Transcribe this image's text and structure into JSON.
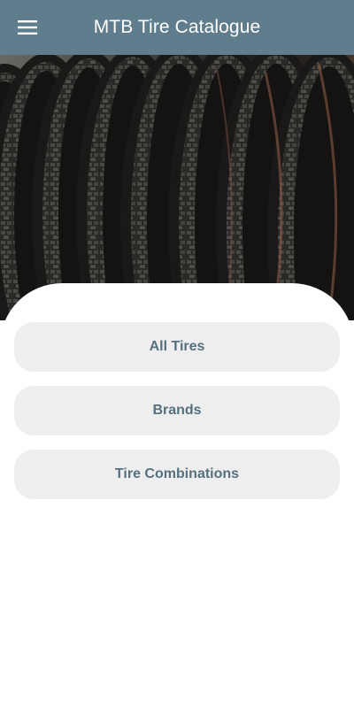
{
  "app_bar": {
    "title": "MTB Tire Catalogue",
    "menu_icon": "hamburger-menu-icon",
    "background_color": "#5f7d8c"
  },
  "hero": {
    "subject": "row of mountain bike tires"
  },
  "menu": {
    "items": [
      {
        "label": "All Tires"
      },
      {
        "label": "Brands"
      },
      {
        "label": "Tire Combinations"
      }
    ],
    "button_color": "#eeeeee",
    "text_color": "#55707e"
  }
}
